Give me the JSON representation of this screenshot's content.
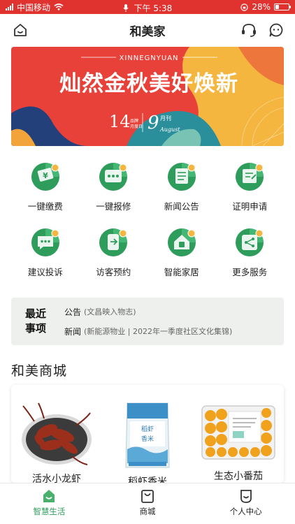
{
  "status_bar": {
    "carrier": "中国移动",
    "time": "下午 5:38",
    "battery": "28%",
    "battery_level": 0.28
  },
  "header": {
    "title": "和美家",
    "left_icon": "home-icon",
    "right_icons": [
      "headset-icon",
      "chat-icon"
    ]
  },
  "banner": {
    "top_text": "XINNEGNYUAN",
    "headline": "灿然金秋美好焕新",
    "num_left": "14",
    "side_text_1": "品牌",
    "side_text_2": "月度日",
    "month": "9",
    "month_unit": "月刊",
    "month_en": "August",
    "colors": {
      "red": "#e8413a",
      "orange": "#f2a33a",
      "teal": "#2a8f9a",
      "yellow": "#f4b63f",
      "navy": "#23407a"
    }
  },
  "services": [
    {
      "label": "一键缴费",
      "icon": "payment-icon"
    },
    {
      "label": "一键报修",
      "icon": "repair-icon"
    },
    {
      "label": "新闻公告",
      "icon": "news-icon"
    },
    {
      "label": "证明申请",
      "icon": "certificate-icon"
    },
    {
      "label": "建议投诉",
      "icon": "feedback-icon"
    },
    {
      "label": "访客预约",
      "icon": "visitor-icon"
    },
    {
      "label": "智能家居",
      "icon": "smart-home-icon"
    },
    {
      "label": "更多服务",
      "icon": "more-services-icon"
    }
  ],
  "recent": {
    "title_line1": "最近",
    "title_line2": "事项",
    "items": [
      {
        "tag": "公告",
        "text": "(文昌映入物志)"
      },
      {
        "tag": "新闻",
        "text": "(新能源物业 | 2022年一季度社区文化集锦)"
      }
    ]
  },
  "mall": {
    "title": "和美商城",
    "products": [
      {
        "name": "活水小龙虾",
        "icon": "crayfish-image"
      },
      {
        "name": "稻虾香米",
        "icon": "rice-bag-image"
      },
      {
        "name": "生态小番茄",
        "icon": "tomato-box-image"
      }
    ]
  },
  "tabbar": {
    "tabs": [
      {
        "label": "智慧生活",
        "icon": "smart-life-icon",
        "active": true
      },
      {
        "label": "商城",
        "icon": "shop-bag-icon",
        "active": false
      },
      {
        "label": "个人中心",
        "icon": "profile-icon",
        "active": false
      }
    ]
  },
  "colors": {
    "accent": "#2e9c5a",
    "status_bar": "#e0322f"
  }
}
